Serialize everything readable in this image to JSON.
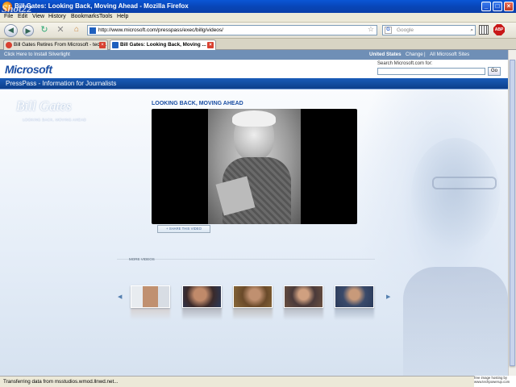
{
  "window": {
    "title": "Bill Gates: Looking Back, Moving Ahead - Mozilla Firefox",
    "watermark": "Shot22"
  },
  "menu": [
    "File",
    "Edit",
    "View",
    "History",
    "Bookmarks",
    "Tools",
    "Help"
  ],
  "nav": {
    "url": "http://www.microsoft.com/presspass/exec/billg/videos/",
    "search_placeholder": "Google"
  },
  "tabs": [
    {
      "label": "Bill Gates Retires From Microsoft - tech...",
      "active": false
    },
    {
      "label": "Bill Gates: Looking Back, Moving ...",
      "active": true
    }
  ],
  "site": {
    "silverlight": "Click Here to Install Silverlight",
    "region": "United States",
    "change": "Change",
    "sep": "|",
    "all_sites": "All Microsoft Sites",
    "logo": "Microsoft",
    "search_label": "Search Microsoft.com for:",
    "go": "Go",
    "presspass": "PressPass - Information for Journalists",
    "signature": "Bill Gates",
    "signature_sub": "LOOKING BACK, MOVING AHEAD",
    "video_title": "LOOKING BACK, MOVING AHEAD",
    "share": "+ SHARE THIS VIDEO",
    "more_videos": "MORE VIDEOS"
  },
  "colors": {
    "ms_blue": "#1b4ea3",
    "bar_blue": "#0d3f8a",
    "silver_bar": "#6f8fb6"
  },
  "status": "Transferring data from msstudios.wmod.llnwd.net...",
  "credit": [
    "free image hosting by",
    "www.techpowerup.com"
  ]
}
